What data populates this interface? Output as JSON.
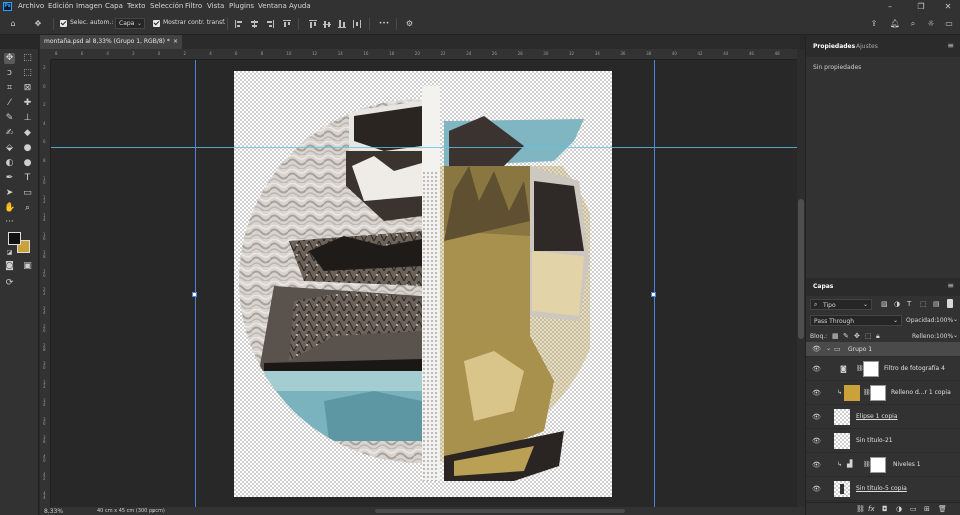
{
  "menubar": {
    "items": [
      "Archivo",
      "Edición",
      "Imagen",
      "Capa",
      "Texto",
      "Selección",
      "Filtro",
      "Vista",
      "Plugins",
      "Ventana",
      "Ayuda"
    ],
    "app_logo": "Ps"
  },
  "options": {
    "auto_select_label": "Selec. autom.:",
    "auto_select_value": "Capa",
    "show_transform_label": "Mostrar contr. transf.",
    "more_label": "•••"
  },
  "document": {
    "tab_title": "montaña.psd al 8,33% (Grupo 1, RGB/8) *",
    "close_glyph": "×",
    "zoom": "8,33%",
    "size_info": "40 cm x 45 cm (300 ppcm)"
  },
  "ruler_top_labels": [
    "8",
    "6",
    "4",
    "2",
    "0",
    "2",
    "4",
    "6",
    "8",
    "10",
    "12",
    "14",
    "16",
    "18",
    "20",
    "22",
    "24",
    "26",
    "28",
    "30",
    "32",
    "34",
    "36",
    "38",
    "40",
    "42",
    "44",
    "46",
    "48"
  ],
  "ruler_left_labels": [
    "2",
    "0",
    "2",
    "4",
    "6",
    "8",
    "1\n0",
    "1\n2",
    "1\n4",
    "1\n6",
    "1\n8",
    "2\n0",
    "2\n2",
    "2\n4",
    "2\n6",
    "2\n8",
    "3\n0",
    "3\n2",
    "3\n4",
    "3\n6",
    "3\n8",
    "4\n0",
    "4\n2",
    "4\n4"
  ],
  "properties": {
    "tab_properties": "Propiedades",
    "tab_adjustments": "Ajustes",
    "empty_text": "Sin propiedades"
  },
  "layers": {
    "tab_label": "Capas",
    "filter_label": "Tipo",
    "blend_mode": "Pass Through",
    "opacity_label": "Opacidad:",
    "opacity_value": "100%",
    "lock_label": "Bloq.:",
    "fill_label": "Relleno:",
    "fill_value": "100%",
    "items": [
      {
        "name": "Grupo 1",
        "kind": "group"
      },
      {
        "name": "Filtro de fotografía 4",
        "kind": "adjustment"
      },
      {
        "name": "Relleno d...r 1 copia",
        "kind": "fill"
      },
      {
        "name": "Elipse 1 copia",
        "kind": "shape"
      },
      {
        "name": "Sin título-21",
        "kind": "pixel"
      },
      {
        "name": "Niveles 1",
        "kind": "levels"
      },
      {
        "name": "Sin título-5 copia",
        "kind": "pixel"
      }
    ]
  },
  "colors": {
    "foreground": "#111111",
    "background": "#c9a23a",
    "gold_fill": "#b89a4a",
    "guide": "#4b83d8",
    "accent_blue": "#31a8ff"
  }
}
